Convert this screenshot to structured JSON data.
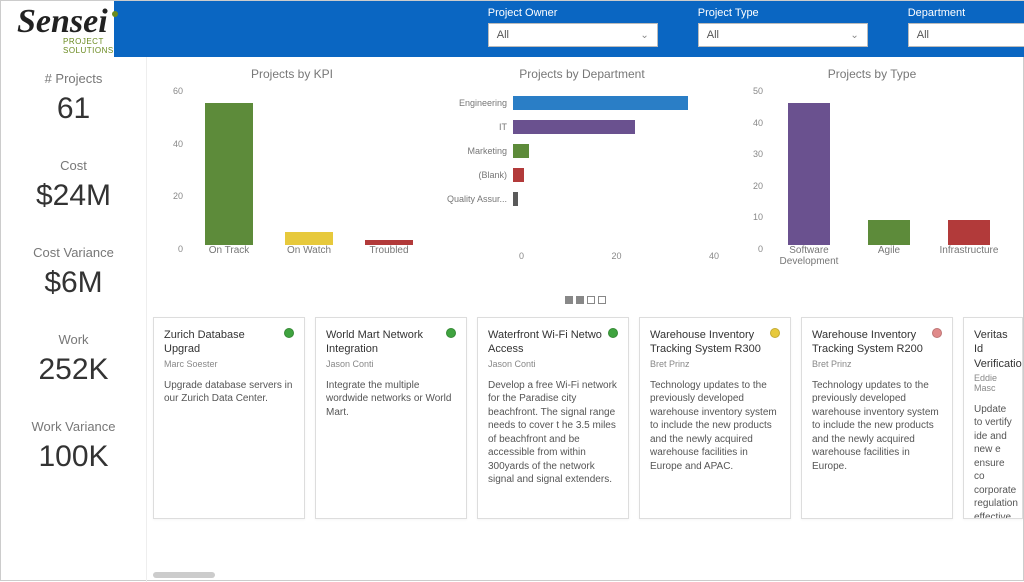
{
  "logo": {
    "name": "Sensei",
    "subtitle": "PROJECT SOLUTIONS"
  },
  "filters": [
    {
      "label": "Project Owner",
      "value": "All"
    },
    {
      "label": "Project Type",
      "value": "All"
    },
    {
      "label": "Department",
      "value": "All"
    }
  ],
  "kpis": [
    {
      "label": "# Projects",
      "value": "61"
    },
    {
      "label": "Cost",
      "value": "$24M"
    },
    {
      "label": "Cost Variance",
      "value": "$6M"
    },
    {
      "label": "Work",
      "value": "252K"
    },
    {
      "label": "Work Variance",
      "value": "100K"
    }
  ],
  "colors": {
    "green": "#5d8b3a",
    "yellow": "#e7c93c",
    "red": "#b23a3a",
    "blue": "#2a7ec6",
    "purple": "#6a518f"
  },
  "chart_data": [
    {
      "type": "bar",
      "title": "Projects by KPI",
      "categories": [
        "On Track",
        "On Watch",
        "Troubled"
      ],
      "values": [
        54,
        5,
        2
      ],
      "colors": [
        "#5d8b3a",
        "#e7c93c",
        "#b23a3a"
      ],
      "ylim": [
        0,
        60
      ],
      "yticks": [
        0,
        20,
        40,
        60
      ]
    },
    {
      "type": "bar",
      "orientation": "horizontal",
      "title": "Projects by Department",
      "categories": [
        "Engineering",
        "IT",
        "Marketing",
        "(Blank)",
        "Quality Assur..."
      ],
      "values": [
        33,
        23,
        3,
        2,
        1
      ],
      "colors": [
        "#2a7ec6",
        "#6a518f",
        "#5d8b3a",
        "#b23a3a",
        "#5a5a5a"
      ],
      "xlim": [
        0,
        40
      ],
      "xticks": [
        0,
        20,
        40
      ]
    },
    {
      "type": "bar",
      "title": "Projects by Type",
      "categories": [
        "Software Development",
        "Agile",
        "Infrastructure"
      ],
      "values": [
        45,
        8,
        8
      ],
      "colors": [
        "#6a518f",
        "#5d8b3a",
        "#b23a3a"
      ],
      "ylim": [
        0,
        50
      ],
      "yticks": [
        0,
        10,
        20,
        30,
        40,
        50
      ]
    }
  ],
  "pager": {
    "total": 4,
    "filled": 2
  },
  "projects": [
    {
      "title": "Zurich Database Upgrad",
      "owner": "Marc Soester",
      "status": "green",
      "desc": "Upgrade database servers in our Zurich Data Center."
    },
    {
      "title": "World Mart Network Integration",
      "owner": "Jason Conti",
      "status": "green",
      "desc": "Integrate the multiple wordwide networks or World Mart."
    },
    {
      "title": "Waterfront Wi-Fi Netwo Access",
      "owner": "Jason Conti",
      "status": "green",
      "desc": "Develop a free Wi-Fi network for the Paradise city beachfront. The signal range needs to cover t he 3.5 miles of beachfront and be accessible from within 300yards of the network signal and signal extenders."
    },
    {
      "title": "Warehouse Inventory Tracking System R300",
      "owner": "Bret Prinz",
      "status": "yellow",
      "desc": "Technology updates to the previously developed warehouse inventory system to include the new products and the newly acquired warehouse facilities in Europe and APAC."
    },
    {
      "title": "Warehouse Inventory Tracking System R200",
      "owner": "Bret Prinz",
      "status": "red",
      "desc": "Technology updates to the previously developed warehouse inventory system to include the new products and the newly acquired warehouse facilities in Europe."
    },
    {
      "title": "Veritas Id Verificatio",
      "owner": "Eddie Masc",
      "status": "",
      "desc": "Update to vertify ide and new e ensure co corporate regulation effective i"
    }
  ],
  "status_colors": {
    "green": "#3fa33f",
    "yellow": "#e7c93c",
    "red": "#e08a8a"
  }
}
